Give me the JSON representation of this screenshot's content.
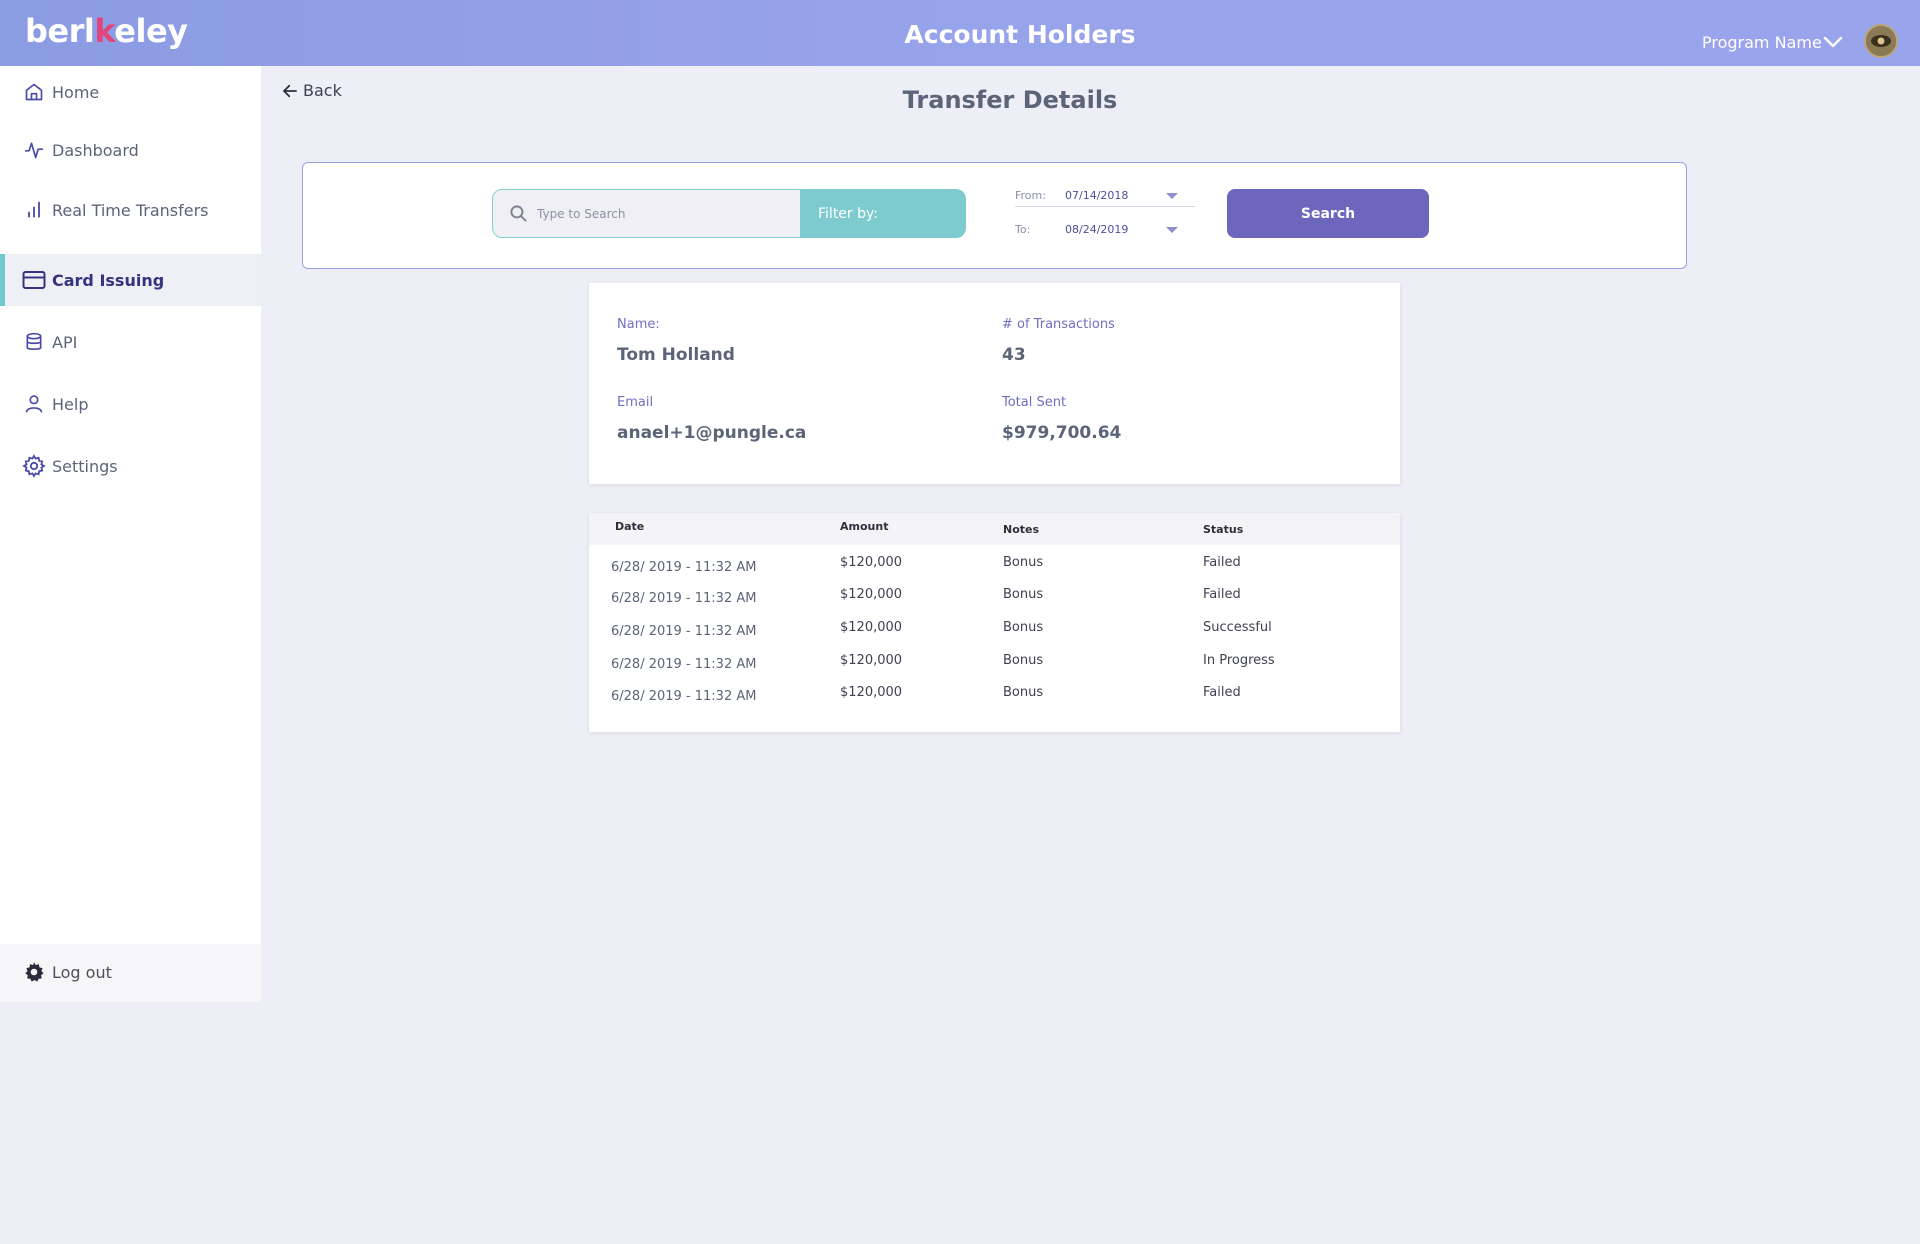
{
  "header": {
    "logo_prefix": "berl",
    "logo_accent": "k",
    "logo_suffix": "eley",
    "title": "Account Holders",
    "program_label": "Program Name"
  },
  "sidebar": {
    "items": [
      {
        "label": "Home",
        "icon": "home-icon"
      },
      {
        "label": "Dashboard",
        "icon": "activity-icon"
      },
      {
        "label": "Real Time Transfers",
        "icon": "bar-chart-icon"
      },
      {
        "label": "Card Issuing",
        "icon": "credit-card-icon",
        "active": true
      },
      {
        "label": "API",
        "icon": "database-icon"
      },
      {
        "label": "Help",
        "icon": "user-icon"
      },
      {
        "label": "Settings",
        "icon": "gear-icon"
      }
    ],
    "logout_label": "Log out"
  },
  "main": {
    "back_label": "Back",
    "page_title": "Transfer Details",
    "search": {
      "placeholder": "Type to Search",
      "filter_label": "Filter by:",
      "from_label": "From:",
      "from_value": "07/14/2018",
      "to_label": "To:",
      "to_value": "08/24/2019",
      "button_label": "Search"
    },
    "account": {
      "name_label": "Name:",
      "name_value": "Tom Holland",
      "transactions_label": "# of Transactions",
      "transactions_value": "43",
      "email_label": "Email",
      "email_value": "anael+1@pungle.ca",
      "total_label": "Total Sent",
      "total_value": "$979,700.64"
    },
    "table": {
      "columns": [
        "Date",
        "Amount",
        "Notes",
        "Status"
      ],
      "rows": [
        [
          "6/28/ 2019 - 11:32 AM",
          "$120,000",
          "Bonus",
          "Failed"
        ],
        [
          "6/28/ 2019 - 11:32 AM",
          "$120,000",
          "Bonus",
          "Failed"
        ],
        [
          "6/28/ 2019 - 11:32 AM",
          "$120,000",
          "Bonus",
          "Successful"
        ],
        [
          "6/28/ 2019 - 11:32 AM",
          "$120,000",
          "Bonus",
          "In Progress"
        ],
        [
          "6/28/ 2019 - 11:32 AM",
          "$120,000",
          "Bonus",
          "Failed"
        ]
      ]
    }
  },
  "colors": {
    "header_gradient_start": "#8c9ce2",
    "accent_purple": "#6c67bd",
    "accent_teal": "#7ecbcf",
    "active_nav_text": "#35347f",
    "page_background": "#eeeef6"
  }
}
